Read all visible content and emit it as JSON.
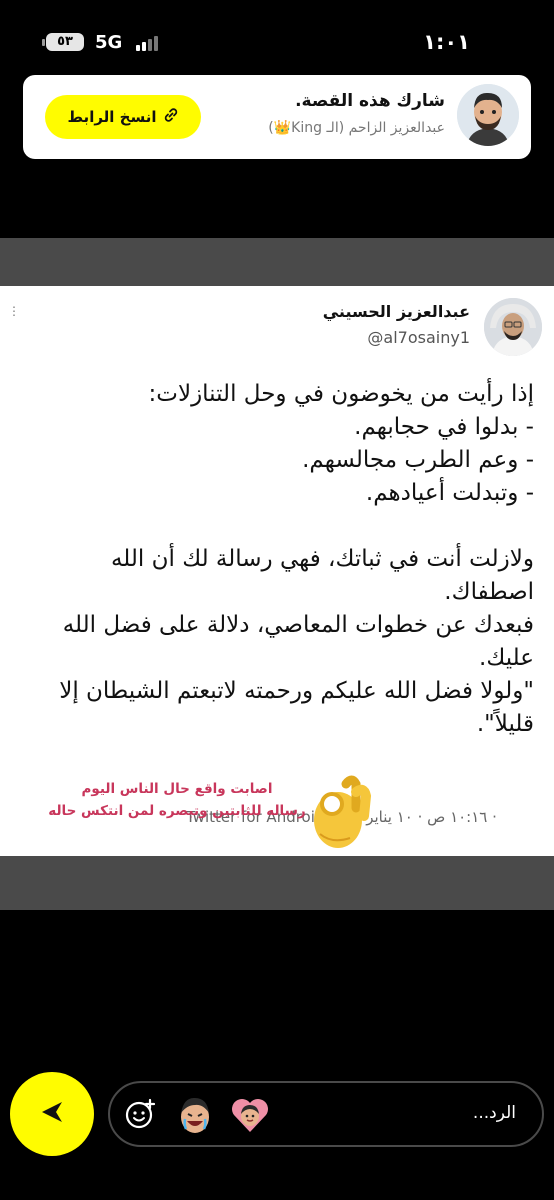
{
  "status": {
    "battery": "٥٣",
    "network": "5G",
    "time": "١:٠١"
  },
  "share_card": {
    "title": "شارك هذه القصة.",
    "subtitle": "عبدالعزيز الزاحم (الـ King👑)",
    "copy_link_label": "انسخ الرابط",
    "accent": "#fffc00"
  },
  "tweet": {
    "author_name": "عبدالعزيز الحسيني",
    "handle": "@al7osainy1",
    "lines": [
      "إذا رأيت من يخوضون في وحل التنازلات:",
      "- بدلوا في حجابهم.",
      "- وعم الطرب مجالسهم.",
      "- وتبدلت أعيادهم.",
      "",
      "ولازلت أنت في ثباتك، فهي رسالة لك أن الله",
      "اصطفاك.",
      "فبعدك عن خطوات المعاصي، دلالة على فضل الله",
      "عليك.",
      "\"ولولا فضل الله عليكم ورحمته لاتبعتم الشيطان إلا",
      "قليلاً\"."
    ],
    "timestamp": "١٠:١٦ ص · ١٠ يناير ٢٠٢٢ ·",
    "source": "Twitter for Android"
  },
  "story_caption": {
    "line1": "اصابت واقع حال الناس اليوم",
    "line2": "رساله للثابتين وتبصره لمن انتكس حاله",
    "color": "#c8365b"
  },
  "bottom_bar": {
    "reply_placeholder": "الرد...",
    "icons": [
      "send-icon",
      "sticker-icon",
      "bitmoji-avatar",
      "bitmoji-heart"
    ]
  }
}
